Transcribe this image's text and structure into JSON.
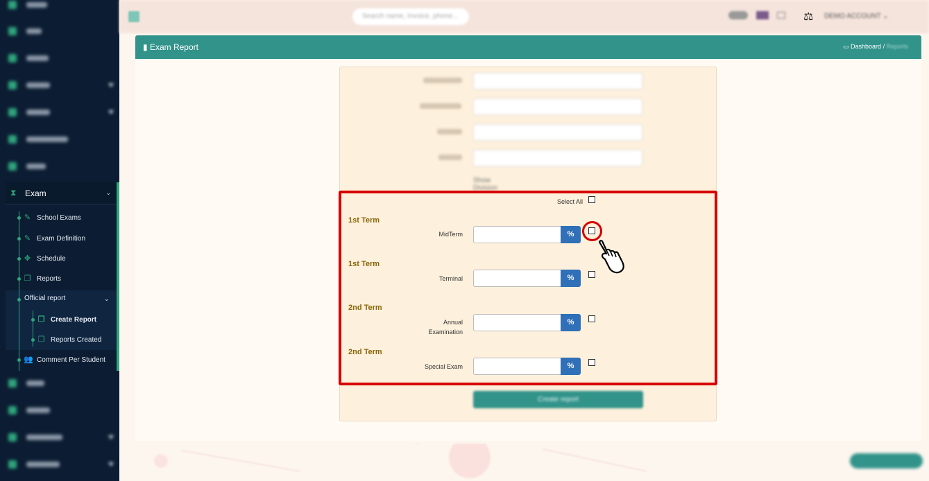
{
  "sidebar": {
    "exam_label": "Exam",
    "sub_items": [
      {
        "label": "School Exams",
        "icon": "pencil-icon"
      },
      {
        "label": "Exam Definition",
        "icon": "pencil-icon"
      },
      {
        "label": "Schedule",
        "icon": "puzzle-icon"
      },
      {
        "label": "Reports",
        "icon": "copy-icon"
      }
    ],
    "official_report": {
      "label": "Official report",
      "children": [
        {
          "label": "Create Report",
          "icon": "copy-icon"
        },
        {
          "label": "Reports Created",
          "icon": "copy-icon"
        }
      ]
    },
    "comment_per_student": "Comment Per Student"
  },
  "topbar": {
    "search_placeholder": "Search name, Invoice, phone...",
    "account": "DEMO ACCOUNT"
  },
  "panel": {
    "title": "Exam Report",
    "breadcrumb": {
      "home": "Dashboard",
      "separator": "/",
      "current": "Reports"
    }
  },
  "form": {
    "select_all_label": "Select All",
    "show_division_label": "Show Division",
    "submit_label": "Create report",
    "rows": [
      {
        "term": "1st Term",
        "exam": "MidTerm",
        "unit": "%"
      },
      {
        "term": "1st Term",
        "exam": "Terminal",
        "unit": "%"
      },
      {
        "term": "2nd Term",
        "exam_line1": "Annual",
        "exam_line2": "Examination",
        "unit": "%"
      },
      {
        "term": "2nd Term",
        "exam": "Special Exam",
        "unit": "%"
      }
    ]
  },
  "colors": {
    "accent": "#31938a",
    "highlight": "#d60000",
    "term_text": "#8b6508",
    "percent_button": "#2f70b8"
  }
}
